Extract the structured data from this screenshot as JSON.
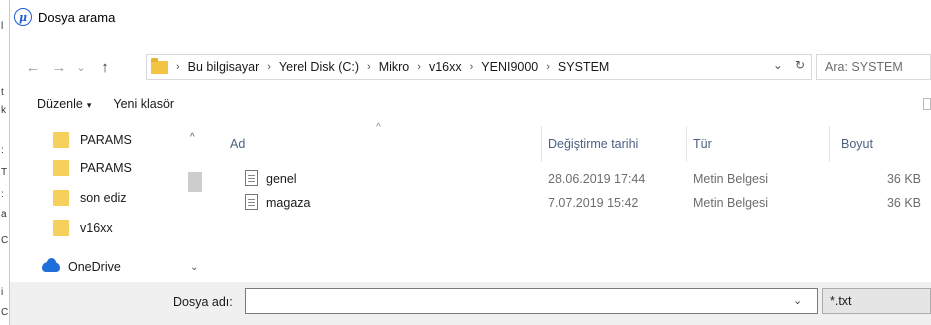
{
  "window": {
    "title": "Dosya arama",
    "app_icon_glyph": "μ"
  },
  "background_strip": {
    "glyphs": [
      "l",
      "t",
      "k",
      ":",
      "T",
      ":",
      "a",
      "C",
      "i",
      "C"
    ]
  },
  "nav": {
    "back_glyph": "←",
    "forward_glyph": "→",
    "recent_glyph": "⌄",
    "up_glyph": "↑",
    "breadcrumb": [
      "Bu bilgisayar",
      "Yerel Disk (C:)",
      "Mikro",
      "v16xx",
      "YENI9000",
      "SYSTEM"
    ],
    "separator": "›",
    "dropdown_glyph": "⌄",
    "refresh_glyph": "↻",
    "search_placeholder": "Ara: SYSTEM"
  },
  "toolbar": {
    "organize_label": "Düzenle",
    "organize_caret": "▾",
    "new_folder_label": "Yeni klasör"
  },
  "nav_pane": {
    "items": [
      {
        "label": "PARAMS",
        "icon": "folder-icon"
      },
      {
        "label": "PARAMS",
        "icon": "folder-icon"
      },
      {
        "label": "son ediz",
        "icon": "folder-icon"
      },
      {
        "label": "v16xx",
        "icon": "folder-icon"
      },
      {
        "label": "OneDrive",
        "icon": "cloud-icon"
      }
    ],
    "scroll_up_glyph": "^",
    "scroll_down_glyph": "⌄"
  },
  "file_list": {
    "sort_glyph": "^",
    "columns": {
      "name": "Ad",
      "modified": "Değiştirme tarihi",
      "type": "Tür",
      "size": "Boyut"
    },
    "rows": [
      {
        "name": "genel",
        "modified": "28.06.2019 17:44",
        "type": "Metin Belgesi",
        "size": "36 KB"
      },
      {
        "name": "magaza",
        "modified": "7.07.2019 15:42",
        "type": "Metin Belgesi",
        "size": "36 KB"
      }
    ]
  },
  "bottom": {
    "filename_label": "Dosya adı:",
    "filename_value": "",
    "filename_dropdown_glyph": "⌄",
    "filetype_value": "*.txt"
  },
  "colors": {
    "accent": "#1d5fd6",
    "folder": "#f7cf5c",
    "onedrive": "#1e6fd9",
    "header_text": "#4d6082"
  }
}
